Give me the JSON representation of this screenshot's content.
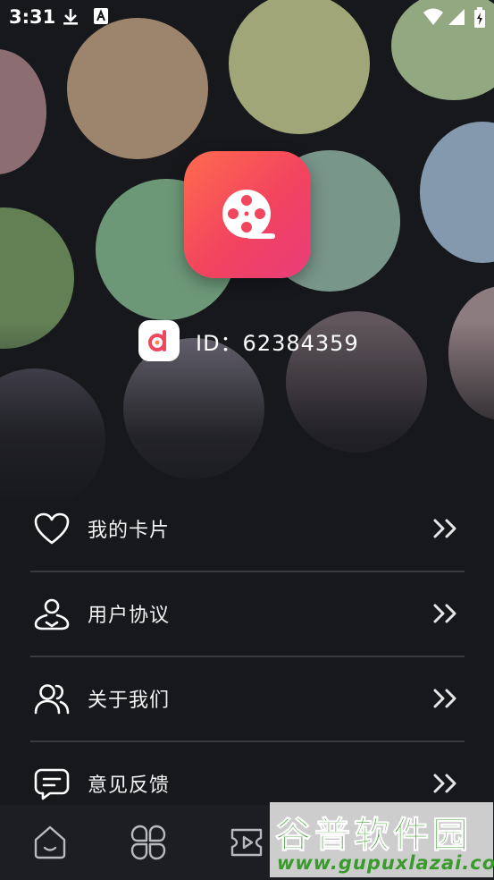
{
  "status_bar": {
    "time": "3:31"
  },
  "profile": {
    "id_text": "ID：62384359"
  },
  "menu": [
    {
      "label": "我的卡片",
      "icon": "heart-icon"
    },
    {
      "label": "用户协议",
      "icon": "user-location-icon"
    },
    {
      "label": "关于我们",
      "icon": "users-icon"
    },
    {
      "label": "意见反馈",
      "icon": "chat-bubble-icon"
    }
  ],
  "tab_bar": [
    {
      "icon": "home-icon"
    },
    {
      "icon": "clover-icon"
    },
    {
      "icon": "video-icon"
    }
  ],
  "watermark": {
    "title": "谷普软件园",
    "url": "www.gupuxlazai.com"
  },
  "colors": {
    "background": "#17181c",
    "accent_start": "#ff6b4e",
    "accent_end": "#e93d7a",
    "watermark": "#3a9b2d"
  }
}
